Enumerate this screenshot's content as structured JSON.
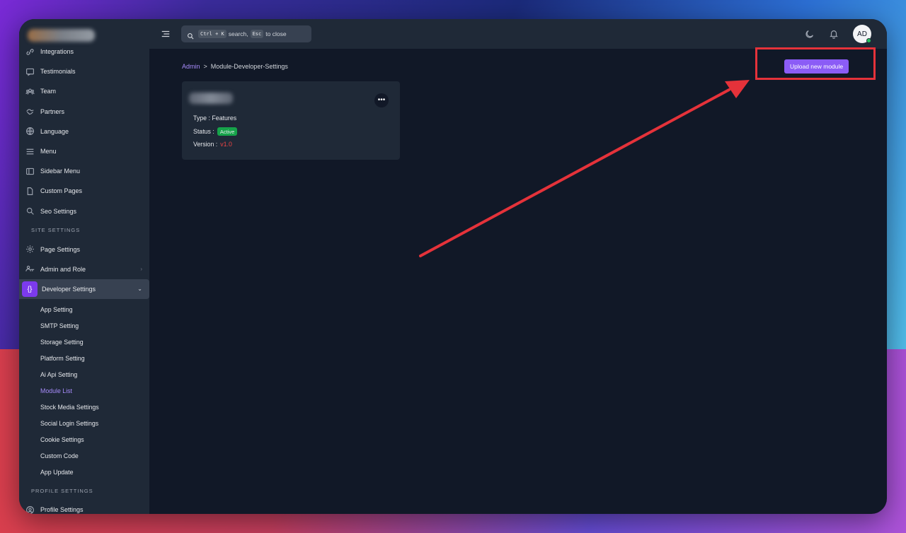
{
  "search": {
    "kbd1": "Ctrl + K",
    "text1": "search,",
    "kbd2": "Esc",
    "text2": "to close"
  },
  "user": {
    "initials": "AD"
  },
  "sidebar": {
    "items_top": [
      {
        "label": "Integrations",
        "icon": "link-icon"
      },
      {
        "label": "Testimonials",
        "icon": "message-icon"
      },
      {
        "label": "Team",
        "icon": "users-icon"
      },
      {
        "label": "Partners",
        "icon": "handshake-icon"
      },
      {
        "label": "Language",
        "icon": "globe-icon"
      },
      {
        "label": "Menu",
        "icon": "menu-icon"
      },
      {
        "label": "Sidebar Menu",
        "icon": "layout-icon"
      },
      {
        "label": "Custom Pages",
        "icon": "file-icon"
      },
      {
        "label": "Seo Settings",
        "icon": "search-icon"
      }
    ],
    "section_site": "SITE SETTINGS",
    "page_settings": "Page Settings",
    "admin_role": "Admin and Role",
    "developer_settings": "Developer Settings",
    "dev_icon": "{}",
    "sub_items": [
      "App Setting",
      "SMTP Setting",
      "Storage Setting",
      "Platform Setting",
      "Ai Api Setting",
      "Module List",
      "Stock Media Settings",
      "Social Login Settings",
      "Cookie Settings",
      "Custom Code",
      "App Update"
    ],
    "section_profile": "PROFILE SETTINGS",
    "profile_settings": "Profile Settings"
  },
  "breadcrumb": {
    "root": "Admin",
    "separator": ">",
    "current": "Module-Developer-Settings"
  },
  "upload_button": "Upload new module",
  "module_card": {
    "more": "•••",
    "type_label": "Type :",
    "type_value": "Features",
    "status_label": "Status :",
    "status_value": "Active",
    "version_label": "Version :",
    "version_value": "v1.0"
  },
  "colors": {
    "accent": "#8b5cf6",
    "highlight": "#e5323a",
    "active_badge": "#16a34a",
    "version": "#ef4444"
  }
}
